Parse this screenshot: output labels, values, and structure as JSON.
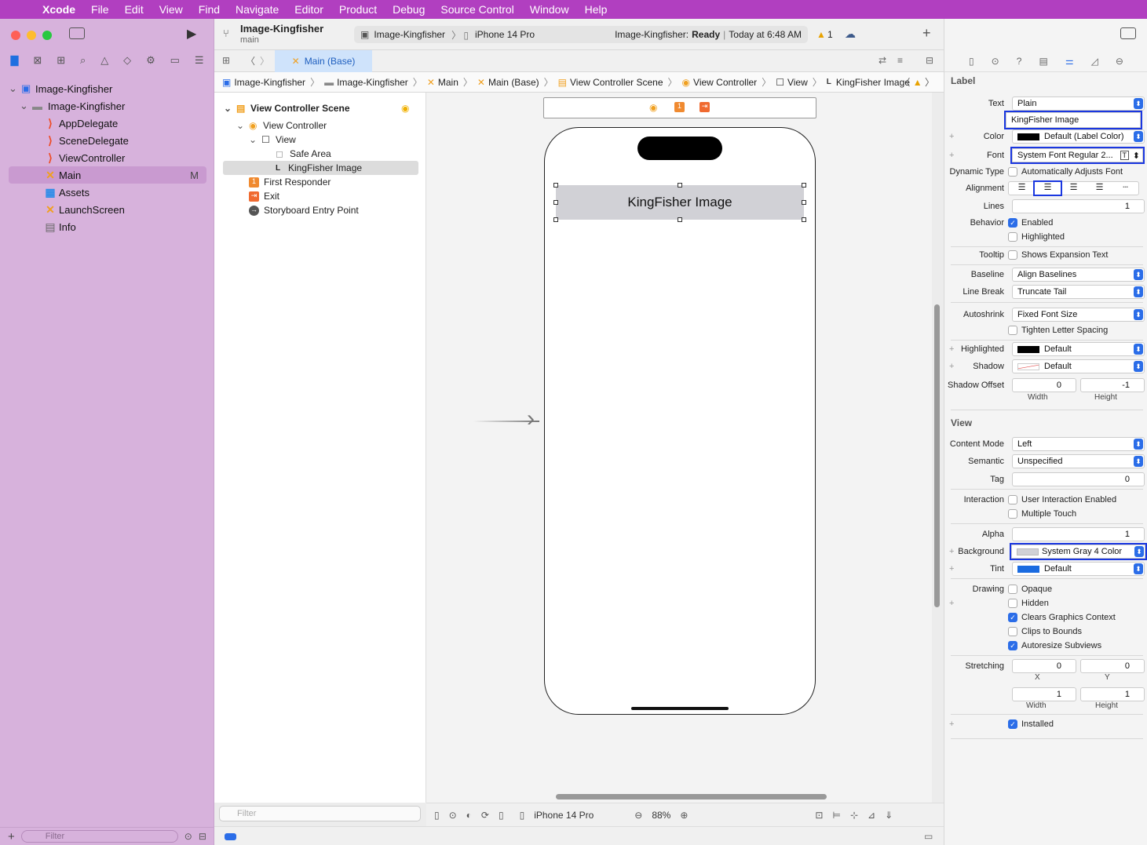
{
  "menubar": {
    "app": "Xcode",
    "items": [
      "File",
      "Edit",
      "View",
      "Find",
      "Navigate",
      "Editor",
      "Product",
      "Debug",
      "Source Control",
      "Window",
      "Help"
    ]
  },
  "navigator": {
    "items": [
      {
        "label": "Image-Kingfisher",
        "kind": "project"
      },
      {
        "label": "Image-Kingfisher",
        "kind": "folder"
      },
      {
        "label": "AppDelegate",
        "kind": "swift"
      },
      {
        "label": "SceneDelegate",
        "kind": "swift"
      },
      {
        "label": "ViewController",
        "kind": "swift"
      },
      {
        "label": "Main",
        "kind": "storyboard",
        "badge": "M"
      },
      {
        "label": "Assets",
        "kind": "assets"
      },
      {
        "label": "LaunchScreen",
        "kind": "storyboard"
      },
      {
        "label": "Info",
        "kind": "plist"
      }
    ],
    "filter_placeholder": "Filter"
  },
  "toolbar": {
    "project": "Image-Kingfisher",
    "branch": "main",
    "scheme": "Image-Kingfisher",
    "device": "iPhone 14 Pro",
    "status_prefix": "Image-Kingfisher:",
    "status_bold": "Ready",
    "status_time": "Today at 6:48 AM",
    "warnings": "1"
  },
  "tab": {
    "label": "Main (Base)"
  },
  "jumpbar": [
    "Image-Kingfisher",
    "Image-Kingfisher",
    "Main",
    "Main (Base)",
    "View Controller Scene",
    "View Controller",
    "View",
    "KingFisher Image"
  ],
  "outline": {
    "scene": "View Controller Scene",
    "vc": "View Controller",
    "view": "View",
    "safe": "Safe Area",
    "label": "KingFisher Image",
    "responder": "First Responder",
    "exit": "Exit",
    "entry": "Storyboard Entry Point",
    "filter_placeholder": "Filter"
  },
  "canvas": {
    "label_text": "KingFisher Image",
    "device": "iPhone 14 Pro",
    "zoom": "88%"
  },
  "inspector": {
    "label_section": "Label",
    "view_section": "View",
    "text_label": "Text",
    "text_type": "Plain",
    "text_value": "KingFisher Image",
    "color_label": "Color",
    "color_value": "Default (Label Color)",
    "font_label": "Font",
    "font_value": "System Font Regular 2...",
    "dynamic_label": "Dynamic Type",
    "dynamic_value": "Automatically Adjusts Font",
    "alignment_label": "Alignment",
    "lines_label": "Lines",
    "lines_value": "1",
    "behavior_label": "Behavior",
    "enabled": "Enabled",
    "highlighted": "Highlighted",
    "tooltip_label": "Tooltip",
    "tooltip_value": "Shows Expansion Text",
    "baseline_label": "Baseline",
    "baseline_value": "Align Baselines",
    "linebreak_label": "Line Break",
    "linebreak_value": "Truncate Tail",
    "autoshrink_label": "Autoshrink",
    "autoshrink_value": "Fixed Font Size",
    "tighten": "Tighten Letter Spacing",
    "hl_label": "Highlighted",
    "hl_value": "Default",
    "shadow_label": "Shadow",
    "shadow_value": "Default",
    "shadowoff_label": "Shadow Offset",
    "shadow_w": "0",
    "shadow_h": "-1",
    "width": "Width",
    "height": "Height",
    "content_label": "Content Mode",
    "content_value": "Left",
    "semantic_label": "Semantic",
    "semantic_value": "Unspecified",
    "tag_label": "Tag",
    "tag_value": "0",
    "interaction_label": "Interaction",
    "uie": "User Interaction Enabled",
    "mt": "Multiple Touch",
    "alpha_label": "Alpha",
    "alpha_value": "1",
    "bg_label": "Background",
    "bg_value": "System Gray 4 Color",
    "tint_label": "Tint",
    "tint_value": "Default",
    "drawing_label": "Drawing",
    "opaque": "Opaque",
    "hidden": "Hidden",
    "clears": "Clears Graphics Context",
    "clips": "Clips to Bounds",
    "autoresize": "Autoresize Subviews",
    "stretch_label": "Stretching",
    "sx": "0",
    "sy": "0",
    "sw": "1",
    "sh": "1",
    "x": "X",
    "y": "Y",
    "installed": "Installed"
  }
}
